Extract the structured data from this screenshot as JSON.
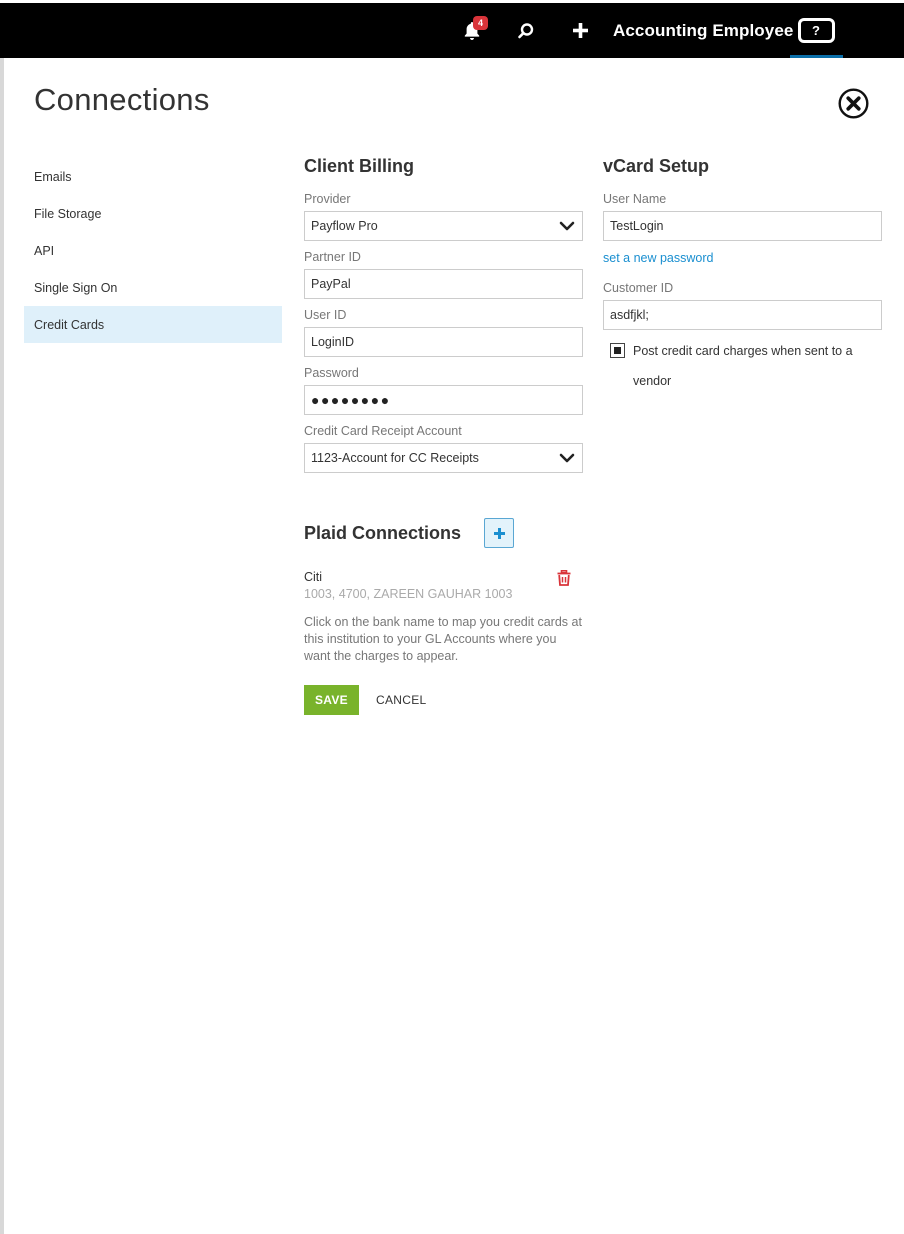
{
  "topbar": {
    "notification_count": "4",
    "user_name": "Accounting Employee",
    "help_label": "?"
  },
  "page": {
    "title": "Connections"
  },
  "sidenav": {
    "items": [
      {
        "label": "Emails"
      },
      {
        "label": "File Storage"
      },
      {
        "label": "API"
      },
      {
        "label": "Single Sign On"
      },
      {
        "label": "Credit Cards",
        "active": true
      }
    ]
  },
  "client_billing": {
    "title": "Client Billing",
    "provider_label": "Provider",
    "provider_value": "Payflow Pro",
    "partner_id_label": "Partner ID",
    "partner_id_value": "PayPal",
    "user_id_label": "User ID",
    "user_id_value": "LoginID",
    "password_label": "Password",
    "password_value": "●●●●●●●●",
    "receipt_account_label": "Credit Card Receipt Account",
    "receipt_account_value": "1123-Account for CC Receipts"
  },
  "vcard": {
    "title": "vCard Setup",
    "user_name_label": "User Name",
    "user_name_value": "TestLogin",
    "set_password_link": "set a new password",
    "customer_id_label": "Customer ID",
    "customer_id_value": "asdfjkl;",
    "post_charges_label": "Post credit card charges when sent to a vendor",
    "post_charges_checked": true
  },
  "plaid": {
    "title": "Plaid Connections",
    "bank_name": "Citi",
    "bank_detail": "1003, 4700, ZAREEN GAUHAR 1003",
    "help_text": "Click on the bank name to map you credit cards at this institution to your GL Accounts where you want the charges to appear."
  },
  "actions": {
    "save_label": "SAVE",
    "cancel_label": "CANCEL"
  },
  "colors": {
    "topbar_bg": "#000000",
    "accent_blue": "#1a8fd0",
    "save_green": "#79b32b",
    "badge_red": "#d9343a",
    "active_nav_bg": "#dff0fa",
    "trash_red": "#d9343a"
  }
}
